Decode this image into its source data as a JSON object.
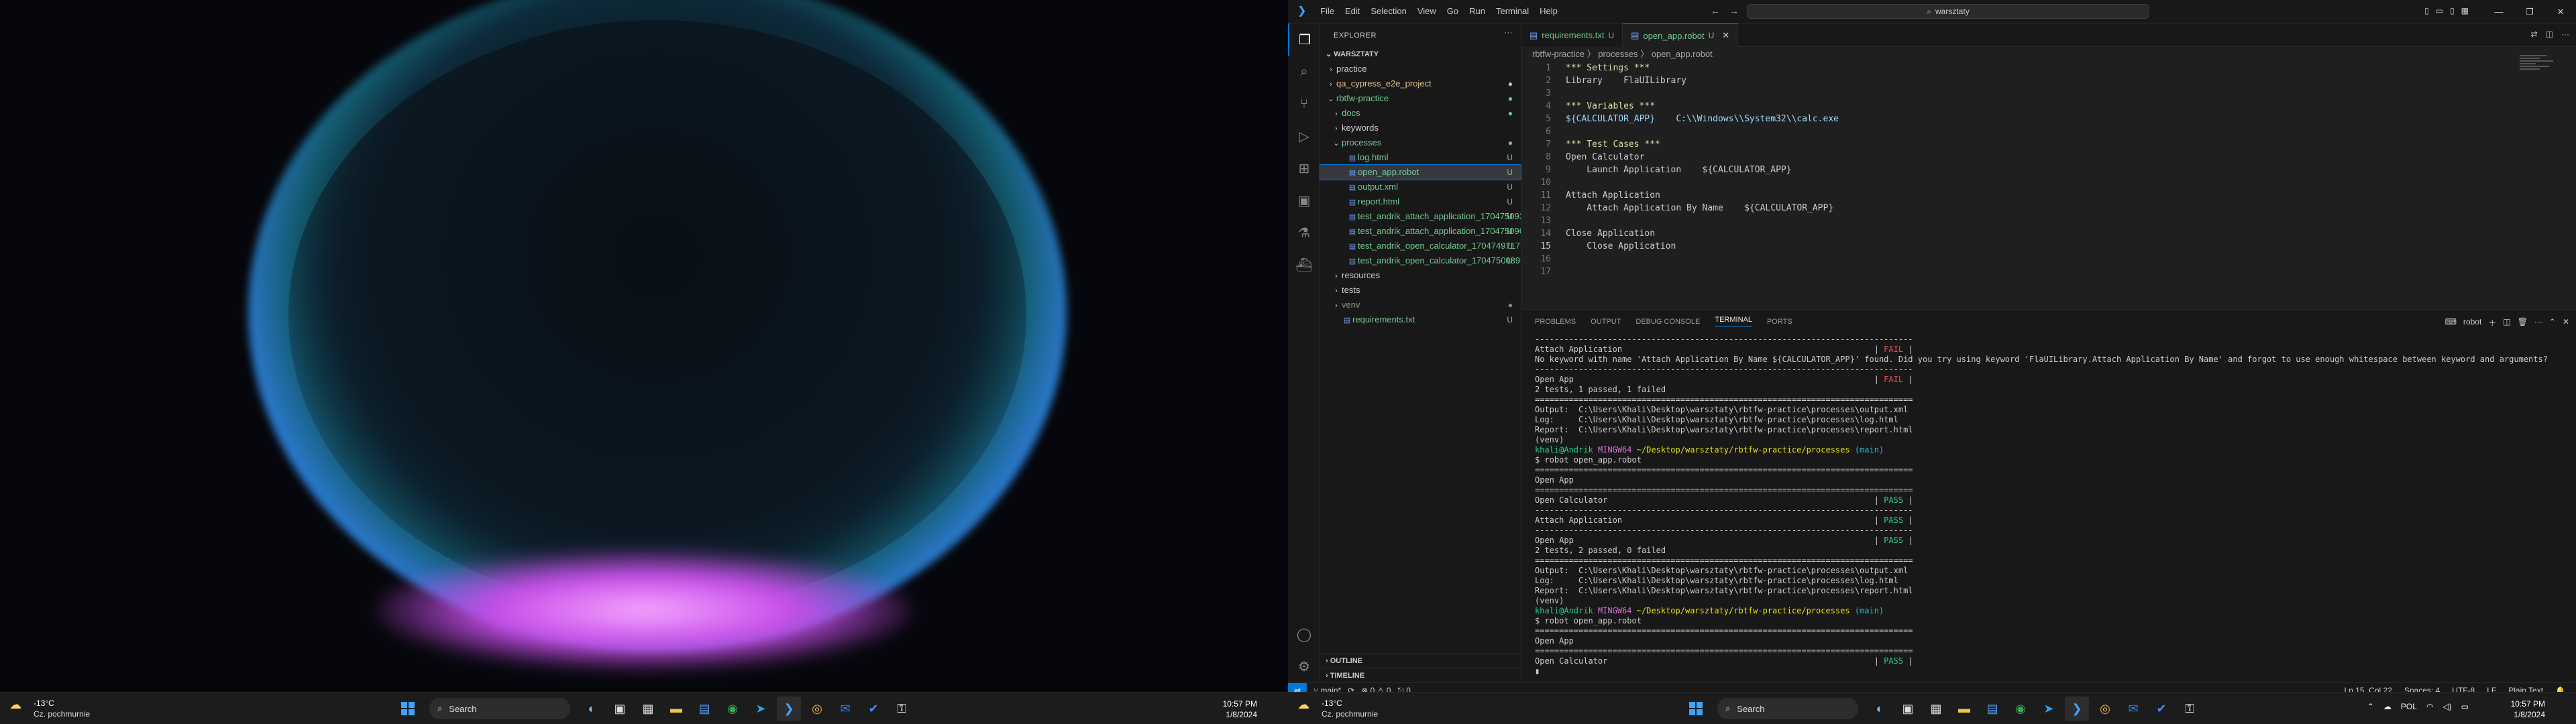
{
  "colors": {
    "accent": "#0078d4",
    "git_added": "#73c991",
    "git_modified": "#e2c08d",
    "fail": "#f14c4c",
    "pass": "#23d18b"
  },
  "taskbar": {
    "weather": {
      "temp": "-13°C",
      "desc": "Cz. pochmurnie"
    },
    "search_placeholder": "Search",
    "clock_time": "10:57 PM",
    "clock_date": "1/8/2024",
    "tray_lang": "POL",
    "apps": [
      "windows-start",
      "search",
      "copilot",
      "task-view",
      "widgets",
      "file-explorer",
      "store",
      "chrome",
      "telegram",
      "vscode",
      "chrome-canary",
      "outlook",
      "todo",
      "vpn"
    ]
  },
  "vscode": {
    "menu": [
      "File",
      "Edit",
      "Selection",
      "View",
      "Go",
      "Run",
      "Terminal",
      "Help"
    ],
    "command_center": "warsztaty",
    "explorer_title": "EXPLORER",
    "workspace": "WARSZTATY",
    "tree": [
      {
        "label": "practice",
        "depth": 0,
        "type": "folder",
        "open": false,
        "color": "def",
        "badge": ""
      },
      {
        "label": "qa_cypress_e2e_project",
        "depth": 0,
        "type": "folder",
        "open": false,
        "color": "mod",
        "badge": "●"
      },
      {
        "label": "rbtfw-practice",
        "depth": 0,
        "type": "folder",
        "open": true,
        "color": "grn",
        "badge": "●"
      },
      {
        "label": "docs",
        "depth": 1,
        "type": "folder",
        "open": false,
        "color": "grn",
        "badge": "●"
      },
      {
        "label": "keywords",
        "depth": 1,
        "type": "folder",
        "open": false,
        "color": "def",
        "badge": ""
      },
      {
        "label": "processes",
        "depth": 1,
        "type": "folder",
        "open": true,
        "color": "grn",
        "badge": "●"
      },
      {
        "label": "log.html",
        "depth": 2,
        "type": "file",
        "open": false,
        "color": "grn",
        "badge": "U"
      },
      {
        "label": "open_app.robot",
        "depth": 2,
        "type": "file",
        "open": false,
        "color": "grn",
        "badge": "U",
        "selected": true
      },
      {
        "label": "output.xml",
        "depth": 2,
        "type": "file",
        "open": false,
        "color": "grn",
        "badge": "U"
      },
      {
        "label": "report.html",
        "depth": 2,
        "type": "file",
        "open": false,
        "color": "grn",
        "badge": "U"
      },
      {
        "label": "test_andrik_attach_application_1704750932731_1.jpg",
        "depth": 2,
        "type": "file",
        "open": false,
        "color": "grn",
        "badge": "U"
      },
      {
        "label": "test_andrik_attach_application_1704750960400_1.jpg",
        "depth": 2,
        "type": "file",
        "open": false,
        "color": "grn",
        "badge": "U"
      },
      {
        "label": "test_andrik_open_calculator_1704749717369_1.jpg",
        "depth": 2,
        "type": "file",
        "open": false,
        "color": "grn",
        "badge": "U"
      },
      {
        "label": "test_andrik_open_calculator_1704750089601_1.jpg",
        "depth": 2,
        "type": "file",
        "open": false,
        "color": "grn",
        "badge": "U"
      },
      {
        "label": "resources",
        "depth": 1,
        "type": "folder",
        "open": false,
        "color": "def",
        "badge": ""
      },
      {
        "label": "tests",
        "depth": 1,
        "type": "folder",
        "open": false,
        "color": "def",
        "badge": ""
      },
      {
        "label": "venv",
        "depth": 1,
        "type": "folder",
        "open": false,
        "color": "ign",
        "badge": "●"
      },
      {
        "label": "requirements.txt",
        "depth": 1,
        "type": "file",
        "open": false,
        "color": "grn",
        "badge": "U"
      }
    ],
    "outline": "OUTLINE",
    "timeline": "TIMELINE",
    "tabs": [
      {
        "label": "requirements.txt",
        "mark": "U",
        "active": false
      },
      {
        "label": "open_app.robot",
        "mark": "U",
        "active": true
      }
    ],
    "breadcrumbs": "rbtfw-practice 〉 processes 〉 open_app.robot",
    "code": [
      "*** Settings ***",
      "Library    FlaUILibrary",
      "",
      "*** Variables ***",
      "${CALCULATOR_APP}    C:\\\\Windows\\\\System32\\\\calc.exe",
      "",
      "*** Test Cases ***",
      "Open Calculator",
      "    Launch Application    ${CALCULATOR_APP}",
      "",
      "Attach Application",
      "    Attach Application By Name    ${CALCULATOR_APP}",
      "",
      "Close Application",
      "    Close Application",
      "",
      ""
    ],
    "current_line": 15,
    "panel_tabs": [
      "PROBLEMS",
      "OUTPUT",
      "DEBUG CONSOLE",
      "TERMINAL",
      "PORTS"
    ],
    "panel_active": "TERMINAL",
    "terminal_name": "robot",
    "terminal": [
      {
        "t": "------------------------------------------------------------------------------",
        "c": ""
      },
      {
        "t": "Attach Application                                                    | FAIL |",
        "c": "fail"
      },
      {
        "t": "No keyword with name 'Attach Application By Name ${CALCULATOR_APP}' found. Did you try using keyword 'FlaUILibrary.Attach Application By Name' and forgot to use enough whitespace between keyword and arguments?",
        "c": ""
      },
      {
        "t": "------------------------------------------------------------------------------",
        "c": ""
      },
      {
        "t": "Open App                                                              | FAIL |",
        "c": "fail"
      },
      {
        "t": "2 tests, 1 passed, 1 failed",
        "c": ""
      },
      {
        "t": "==============================================================================",
        "c": ""
      },
      {
        "t": "Output:  C:\\Users\\Khali\\Desktop\\warsztaty\\rbtfw-practice\\processes\\output.xml",
        "c": ""
      },
      {
        "t": "Log:     C:\\Users\\Khali\\Desktop\\warsztaty\\rbtfw-practice\\processes\\log.html",
        "c": ""
      },
      {
        "t": "Report:  C:\\Users\\Khali\\Desktop\\warsztaty\\rbtfw-practice\\processes\\report.html",
        "c": ""
      },
      {
        "t": "(venv)",
        "c": ""
      },
      {
        "t": "khali@Andrik MINGW64 ~/Desktop/warsztaty/rbtfw-practice/processes (main)",
        "c": "prompt"
      },
      {
        "t": "$ robot open_app.robot",
        "c": ""
      },
      {
        "t": "==============================================================================",
        "c": ""
      },
      {
        "t": "Open App",
        "c": ""
      },
      {
        "t": "==============================================================================",
        "c": ""
      },
      {
        "t": "Open Calculator                                                       | PASS |",
        "c": "pass"
      },
      {
        "t": "------------------------------------------------------------------------------",
        "c": ""
      },
      {
        "t": "Attach Application                                                    | PASS |",
        "c": "pass"
      },
      {
        "t": "------------------------------------------------------------------------------",
        "c": ""
      },
      {
        "t": "Open App                                                              | PASS |",
        "c": "pass"
      },
      {
        "t": "2 tests, 2 passed, 0 failed",
        "c": ""
      },
      {
        "t": "==============================================================================",
        "c": ""
      },
      {
        "t": "Output:  C:\\Users\\Khali\\Desktop\\warsztaty\\rbtfw-practice\\processes\\output.xml",
        "c": ""
      },
      {
        "t": "Log:     C:\\Users\\Khali\\Desktop\\warsztaty\\rbtfw-practice\\processes\\log.html",
        "c": ""
      },
      {
        "t": "Report:  C:\\Users\\Khali\\Desktop\\warsztaty\\rbtfw-practice\\processes\\report.html",
        "c": ""
      },
      {
        "t": "(venv)",
        "c": ""
      },
      {
        "t": "khali@Andrik MINGW64 ~/Desktop/warsztaty/rbtfw-practice/processes (main)",
        "c": "prompt"
      },
      {
        "t": "$ robot open_app.robot",
        "c": ""
      },
      {
        "t": "==============================================================================",
        "c": ""
      },
      {
        "t": "Open App",
        "c": ""
      },
      {
        "t": "==============================================================================",
        "c": ""
      },
      {
        "t": "Open Calculator                                                       | PASS |",
        "c": "pass"
      },
      {
        "t": "▮",
        "c": ""
      }
    ],
    "status": {
      "branch": "main*",
      "problems": "⊗ 0 ⚠ 0",
      "ports": "0",
      "position": "Ln 15, Col 22",
      "spaces": "Spaces: 4",
      "encoding": "UTF-8",
      "eol": "LF",
      "language": "Plain Text"
    }
  }
}
